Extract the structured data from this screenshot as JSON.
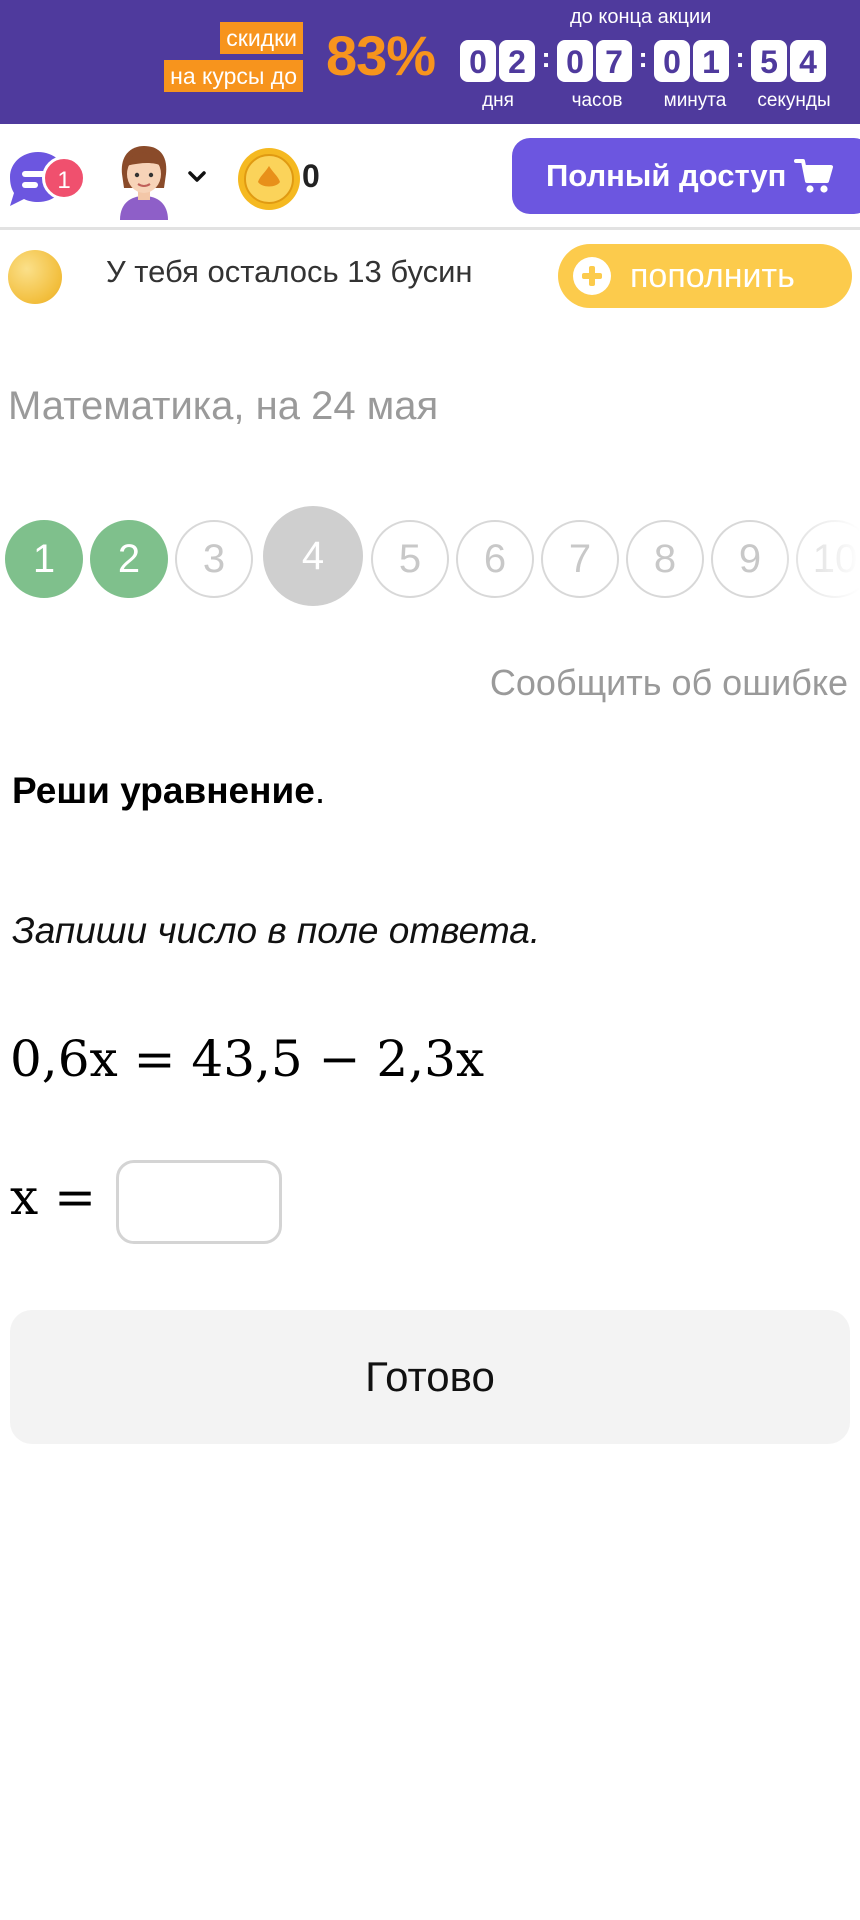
{
  "promo": {
    "tag_line1": "скидки",
    "tag_line2": "на курсы до",
    "percent": "83%",
    "caption": "до конца акции",
    "timer": {
      "days": [
        "0",
        "2"
      ],
      "hours": [
        "0",
        "7"
      ],
      "minutes": [
        "0",
        "1"
      ],
      "seconds": [
        "5",
        "4"
      ],
      "separator": ":"
    },
    "units": {
      "days": "дня",
      "hours": "часов",
      "minutes": "минута",
      "seconds": "секунды"
    },
    "colors": {
      "background": "#4f3a9d",
      "accent": "#f7941d"
    }
  },
  "nav": {
    "chat_badge": "1",
    "coin_count": "0",
    "full_access_label": "Полный доступ",
    "icons": [
      "chat-icon",
      "avatar-icon",
      "chevron-down-icon",
      "coin-icon",
      "cart-icon"
    ],
    "colors": {
      "full_access": "#6c56e0",
      "badge": "#f0506e",
      "coin": "#f5b921"
    }
  },
  "beads": {
    "text": "У тебя осталось 13 бусин",
    "topup_label": "пополнить",
    "icons": [
      "bead-icon",
      "plus-circle-icon"
    ],
    "colors": {
      "topup": "#fccb4c"
    }
  },
  "lesson": {
    "subject": "Математика, на 24 мая",
    "steps": [
      {
        "label": "1",
        "state": "done"
      },
      {
        "label": "2",
        "state": "done"
      },
      {
        "label": "3",
        "state": "pending"
      },
      {
        "label": "4",
        "state": "current"
      },
      {
        "label": "5",
        "state": "pending"
      },
      {
        "label": "6",
        "state": "pending"
      },
      {
        "label": "7",
        "state": "pending"
      },
      {
        "label": "8",
        "state": "pending"
      },
      {
        "label": "9",
        "state": "pending"
      },
      {
        "label": "10",
        "state": "pending"
      }
    ],
    "colors": {
      "done": "#7fc08c",
      "current": "#cfcfcf",
      "pending_border": "#d8d8d8"
    },
    "report_error": "Сообщить об ошибке"
  },
  "task": {
    "title_bold": "Реши уравнение",
    "title_suffix": ".",
    "hint": "Запиши число в поле ответа.",
    "equation": "0,6x = 43,5 − 2,3x",
    "answer_label": "x =",
    "answer_value": "",
    "submit_label": "Готово"
  }
}
